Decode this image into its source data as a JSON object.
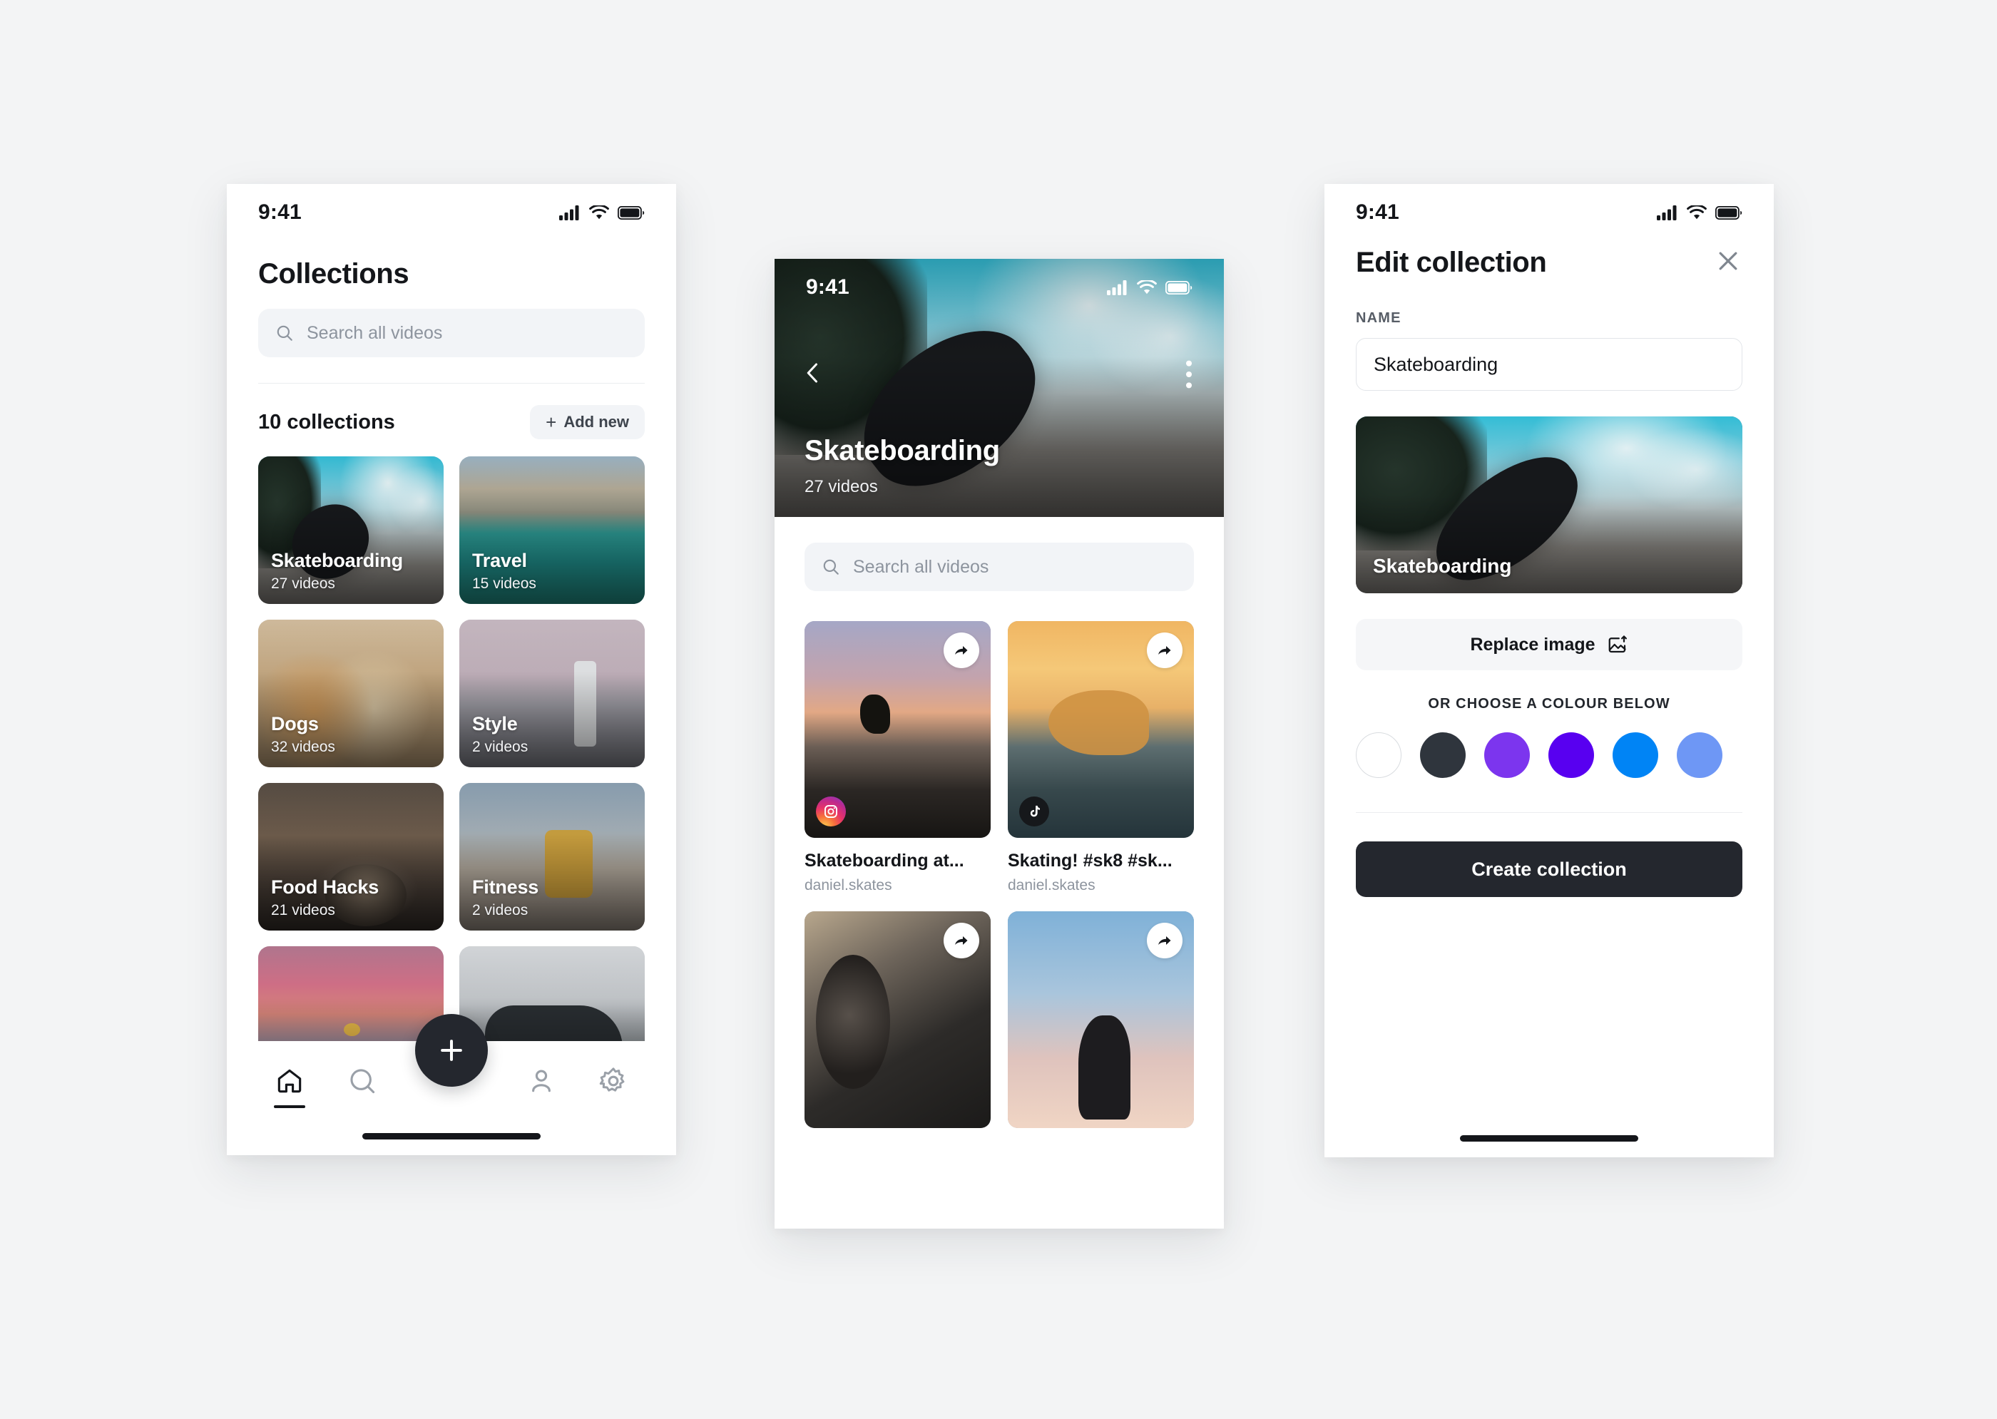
{
  "colors": {
    "background": "#f3f4f5",
    "surface": "#ffffff",
    "ink": "#14161a",
    "muted": "#8d949e",
    "chip": "#f2f4f7",
    "dark_button": "#24272e"
  },
  "screens": {
    "collections": {
      "status_bar": {
        "time": "9:41"
      },
      "title": "Collections",
      "search": {
        "placeholder": "Search all videos"
      },
      "list_header": {
        "count_label": "10 collections",
        "add_button": "Add new",
        "add_icon": "plus-icon"
      },
      "cards": [
        {
          "name": "Skateboarding",
          "videos": "27 videos",
          "photo": "ph-skate"
        },
        {
          "name": "Travel",
          "videos": "15 videos",
          "photo": "ph-travel"
        },
        {
          "name": "Dogs",
          "videos": "32 videos",
          "photo": "ph-dogs"
        },
        {
          "name": "Style",
          "videos": "2 videos",
          "photo": "ph-style"
        },
        {
          "name": "Food Hacks",
          "videos": "21 videos",
          "photo": "ph-food"
        },
        {
          "name": "Fitness",
          "videos": "2 videos",
          "photo": "ph-fitness"
        },
        {
          "name": "",
          "videos": "",
          "photo": "ph-sunset"
        },
        {
          "name": "",
          "videos": "",
          "photo": "ph-car"
        }
      ],
      "tabs": [
        {
          "id": "home",
          "icon": "home-icon",
          "active": true
        },
        {
          "id": "search",
          "icon": "search-icon",
          "active": false
        },
        {
          "id": "profile",
          "icon": "person-icon",
          "active": false
        },
        {
          "id": "settings",
          "icon": "gear-icon",
          "active": false
        }
      ],
      "fab": {
        "icon": "plus-icon"
      }
    },
    "detail": {
      "status_bar": {
        "time": "9:41"
      },
      "back_icon": "chevron-left-icon",
      "more_icon": "more-vertical-icon",
      "hero": {
        "title": "Skateboarding",
        "subtitle": "27 videos",
        "photo": "ph-skate"
      },
      "search": {
        "placeholder": "Search all videos"
      },
      "videos": [
        {
          "title": "Skateboarding at...",
          "user": "daniel.skates",
          "source": "instagram",
          "share_icon": "share-icon",
          "photo": "ph-venice"
        },
        {
          "title": "Skating! #sk8 #sk...",
          "user": "daniel.skates",
          "source": "tiktok",
          "share_icon": "share-icon",
          "photo": "ph-sunbowl"
        },
        {
          "title": "",
          "user": "",
          "source": "none",
          "share_icon": "share-icon",
          "photo": "ph-wheel"
        },
        {
          "title": "",
          "user": "",
          "source": "none",
          "share_icon": "share-icon",
          "photo": "ph-sky"
        }
      ]
    },
    "edit": {
      "status_bar": {
        "time": "9:41"
      },
      "title": "Edit collection",
      "close_icon": "close-icon",
      "name_label": "NAME",
      "name_value": "Skateboarding",
      "preview": {
        "label": "Skateboarding",
        "photo": "ph-skate"
      },
      "replace_button": {
        "label": "Replace image",
        "icon": "image-upload-icon"
      },
      "choose_colour_label": "OR CHOOSE A COLOUR BELOW",
      "swatches": [
        {
          "name": "white",
          "hex": "#ffffff",
          "outlined": true
        },
        {
          "name": "charcoal",
          "hex": "#2f353d",
          "outlined": false
        },
        {
          "name": "purple",
          "hex": "#7c35ee",
          "outlined": false
        },
        {
          "name": "violet",
          "hex": "#5800f0",
          "outlined": false
        },
        {
          "name": "blue",
          "hex": "#0084f5",
          "outlined": false
        },
        {
          "name": "light-blue",
          "hex": "#6e97f5",
          "outlined": false
        }
      ],
      "primary_button": "Create collection"
    }
  }
}
